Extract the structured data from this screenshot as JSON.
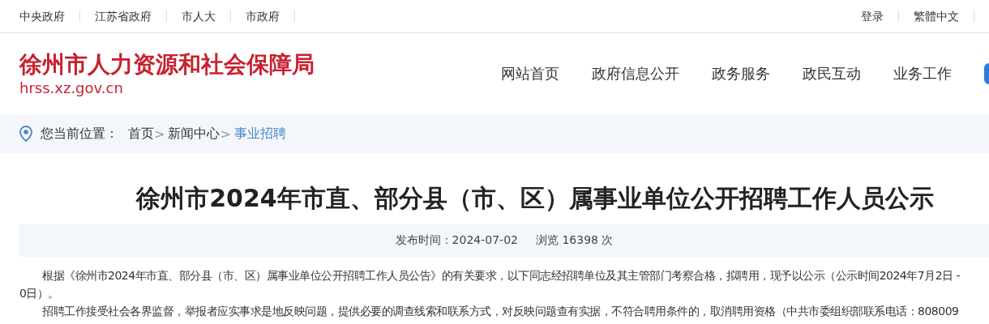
{
  "top_bar": {
    "left_links": [
      "中央政府",
      "江苏省政府",
      "市人大",
      "市政府"
    ],
    "right_links": [
      "登录",
      "繁體中文"
    ]
  },
  "header": {
    "site_name": "徐州市人力资源和社会保障局",
    "site_url": "hrss.xz.gov.cn",
    "nav": [
      "网站首页",
      "政府信息公开",
      "政务服务",
      "政民互动",
      "业务工作"
    ]
  },
  "breadcrumb": {
    "label": "您当前位置：",
    "items": [
      {
        "text": "首页",
        "current": false
      },
      {
        "text": "新闻中心",
        "current": false
      },
      {
        "text": "事业招聘",
        "current": true
      }
    ],
    "separator": ">"
  },
  "article": {
    "title": "徐州市2024年市直、部分县（市、区）属事业单位公开招聘工作人员公示",
    "publish_time": "发布时间：2024-07-02",
    "views": "浏览 16398 次",
    "paragraphs": [
      {
        "lines": [
          "根据《徐州市2024年市直、部分县（市、区）属事业单位公开招聘工作人员公告》的有关要求，以下同志经招聘单位及其主管部门考察合格，拟聘用，现予以公示（公示时间2024年7月2日 -",
          "0日）。"
        ]
      },
      {
        "lines": [
          "招聘工作接受社会各界监督，举报者应实事求是地反映问题，提供必要的调查线索和联系方式，对反映问题查有实据，不符合聘用条件的，取消聘用资格（中共市委组织部联系电话：808009"
        ]
      }
    ]
  }
}
